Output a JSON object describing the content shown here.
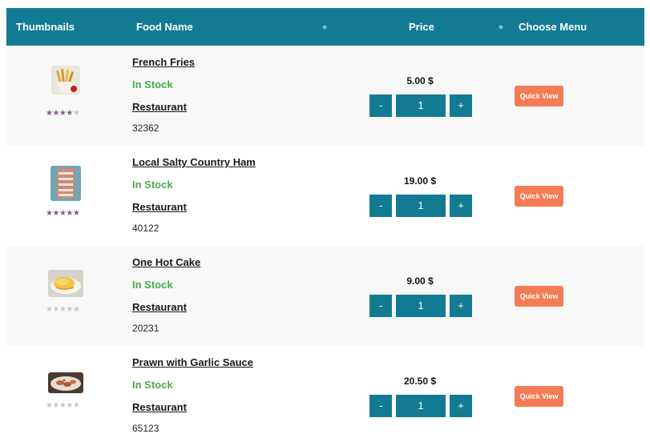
{
  "table": {
    "headers": {
      "thumbnails": "Thumbnails",
      "food_name": "Food Name",
      "price": "Price",
      "choose_menu": "Choose Menu"
    },
    "sort_icon": "sort-icon",
    "rows": [
      {
        "name": "French Fries",
        "stock": "In Stock",
        "restaurant": "Restaurant",
        "code": "32362",
        "price": "5.00 $",
        "quantity": "1",
        "rating": 4,
        "rating_max": 5,
        "quick_view": "Quick View",
        "minus": "-",
        "plus": "+",
        "thumb_icon": "french-fries-image"
      },
      {
        "name": "Local Salty Country Ham",
        "stock": "In Stock",
        "restaurant": "Restaurant",
        "code": "40122",
        "price": "19.00 $",
        "quantity": "1",
        "rating": 5,
        "rating_max": 5,
        "quick_view": "Quick View",
        "minus": "-",
        "plus": "+",
        "thumb_icon": "ham-image"
      },
      {
        "name": "One Hot Cake",
        "stock": "In Stock",
        "restaurant": "Restaurant",
        "code": "20231",
        "price": "9.00 $",
        "quantity": "1",
        "rating": 0,
        "rating_max": 5,
        "quick_view": "Quick View",
        "minus": "-",
        "plus": "+",
        "thumb_icon": "hot-cake-image"
      },
      {
        "name": "Prawn with Garlic Sauce",
        "stock": "In Stock",
        "restaurant": "Restaurant",
        "code": "65123",
        "price": "20.50 $",
        "quantity": "1",
        "rating": 0,
        "rating_max": 5,
        "quick_view": "Quick View",
        "minus": "-",
        "plus": "+",
        "thumb_icon": "prawn-image"
      }
    ]
  },
  "colors": {
    "header_bg": "#127b93",
    "stock_green": "#4caa4a",
    "quick_view_orange": "#f47c55",
    "star_on": "#8b5a8c",
    "star_off": "#c7c7c7"
  }
}
